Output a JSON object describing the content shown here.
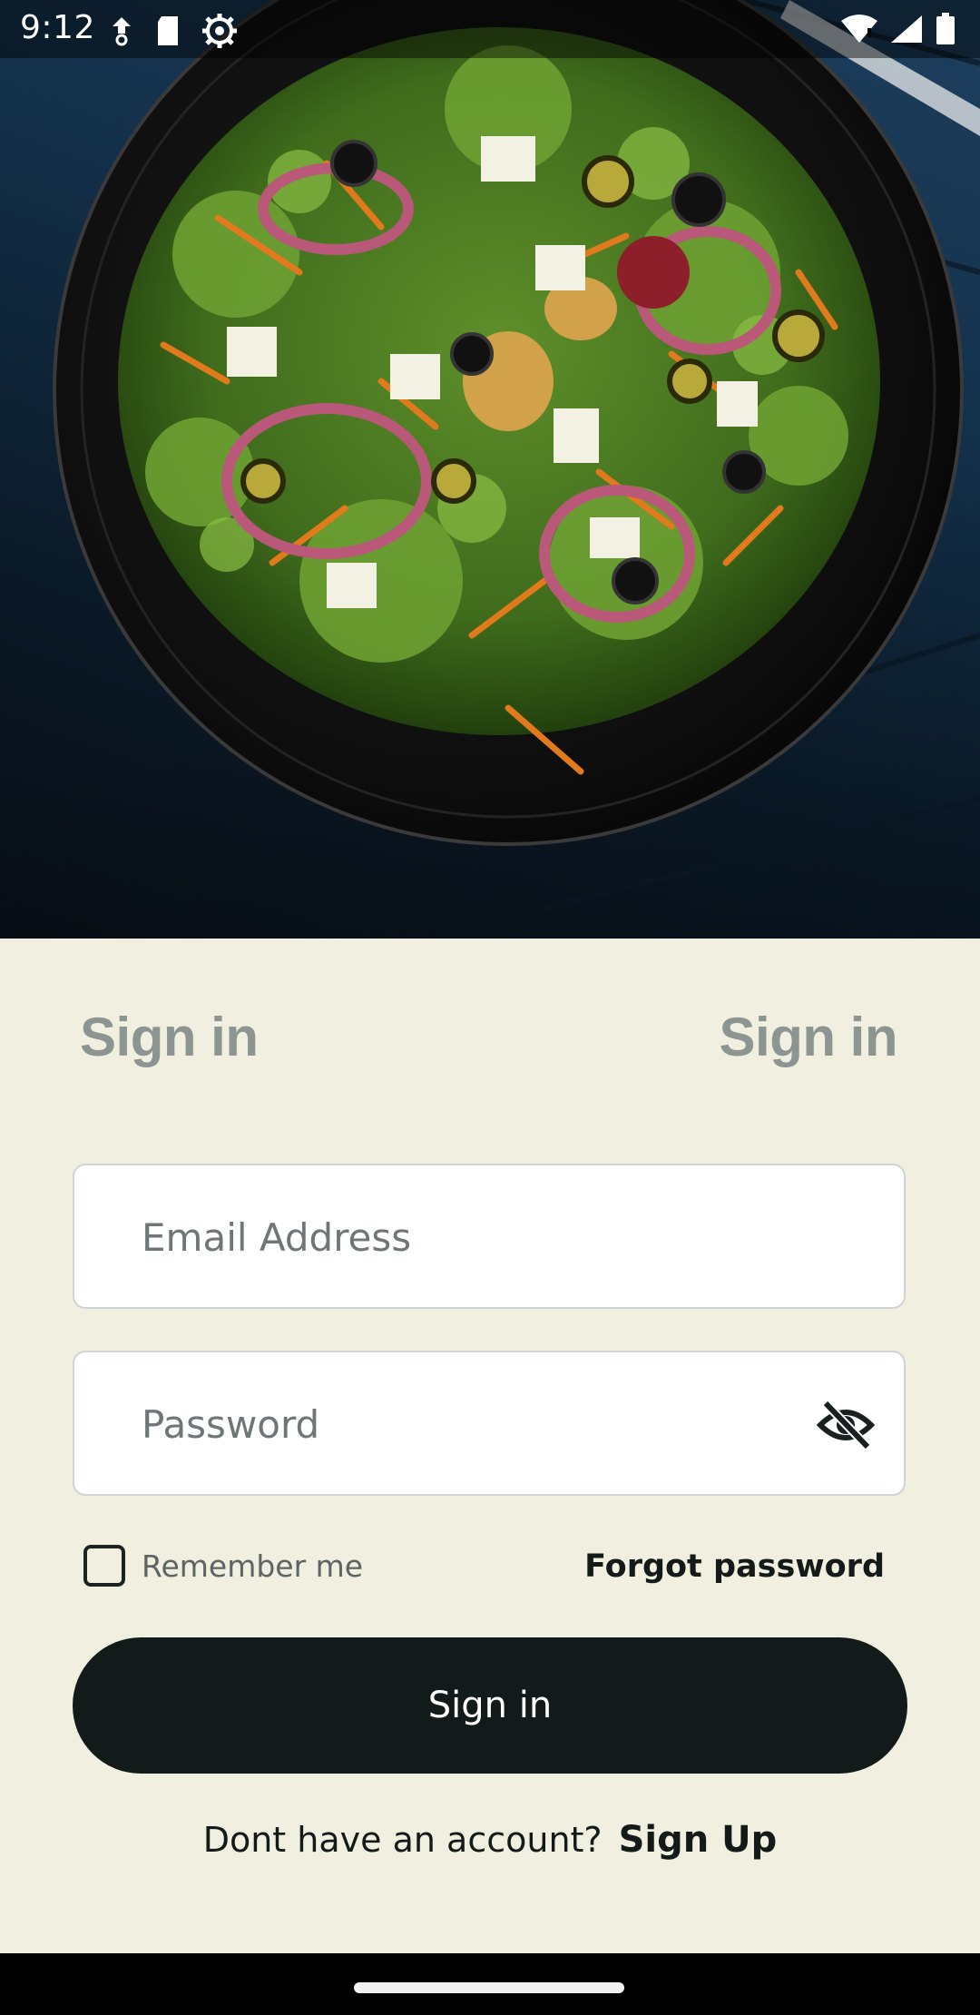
{
  "status_bar": {
    "time": "9:12",
    "left_icons": [
      "data-saver-icon",
      "sd-card-icon",
      "settings-gear-icon"
    ],
    "right_icons": [
      "wifi-icon",
      "cell-signal-icon",
      "battery-icon"
    ]
  },
  "hero": {
    "image": "salad-bowl-photo"
  },
  "tabs": [
    {
      "label": "Sign in"
    },
    {
      "label": "Sign in"
    }
  ],
  "form": {
    "email": {
      "placeholder": "Email Address",
      "value": ""
    },
    "password": {
      "placeholder": "Password",
      "value": "",
      "toggle_icon": "eye-off-icon"
    },
    "remember_me": {
      "label": "Remember me",
      "checked": false
    },
    "forgot_password": "Forgot password",
    "submit_label": "Sign in"
  },
  "footer": {
    "prompt": "Dont have an account?",
    "signup_label": "Sign Up"
  },
  "colors": {
    "background": "#f1efdf",
    "primary_button": "#121a1a",
    "tab_text": "#8c9592"
  }
}
